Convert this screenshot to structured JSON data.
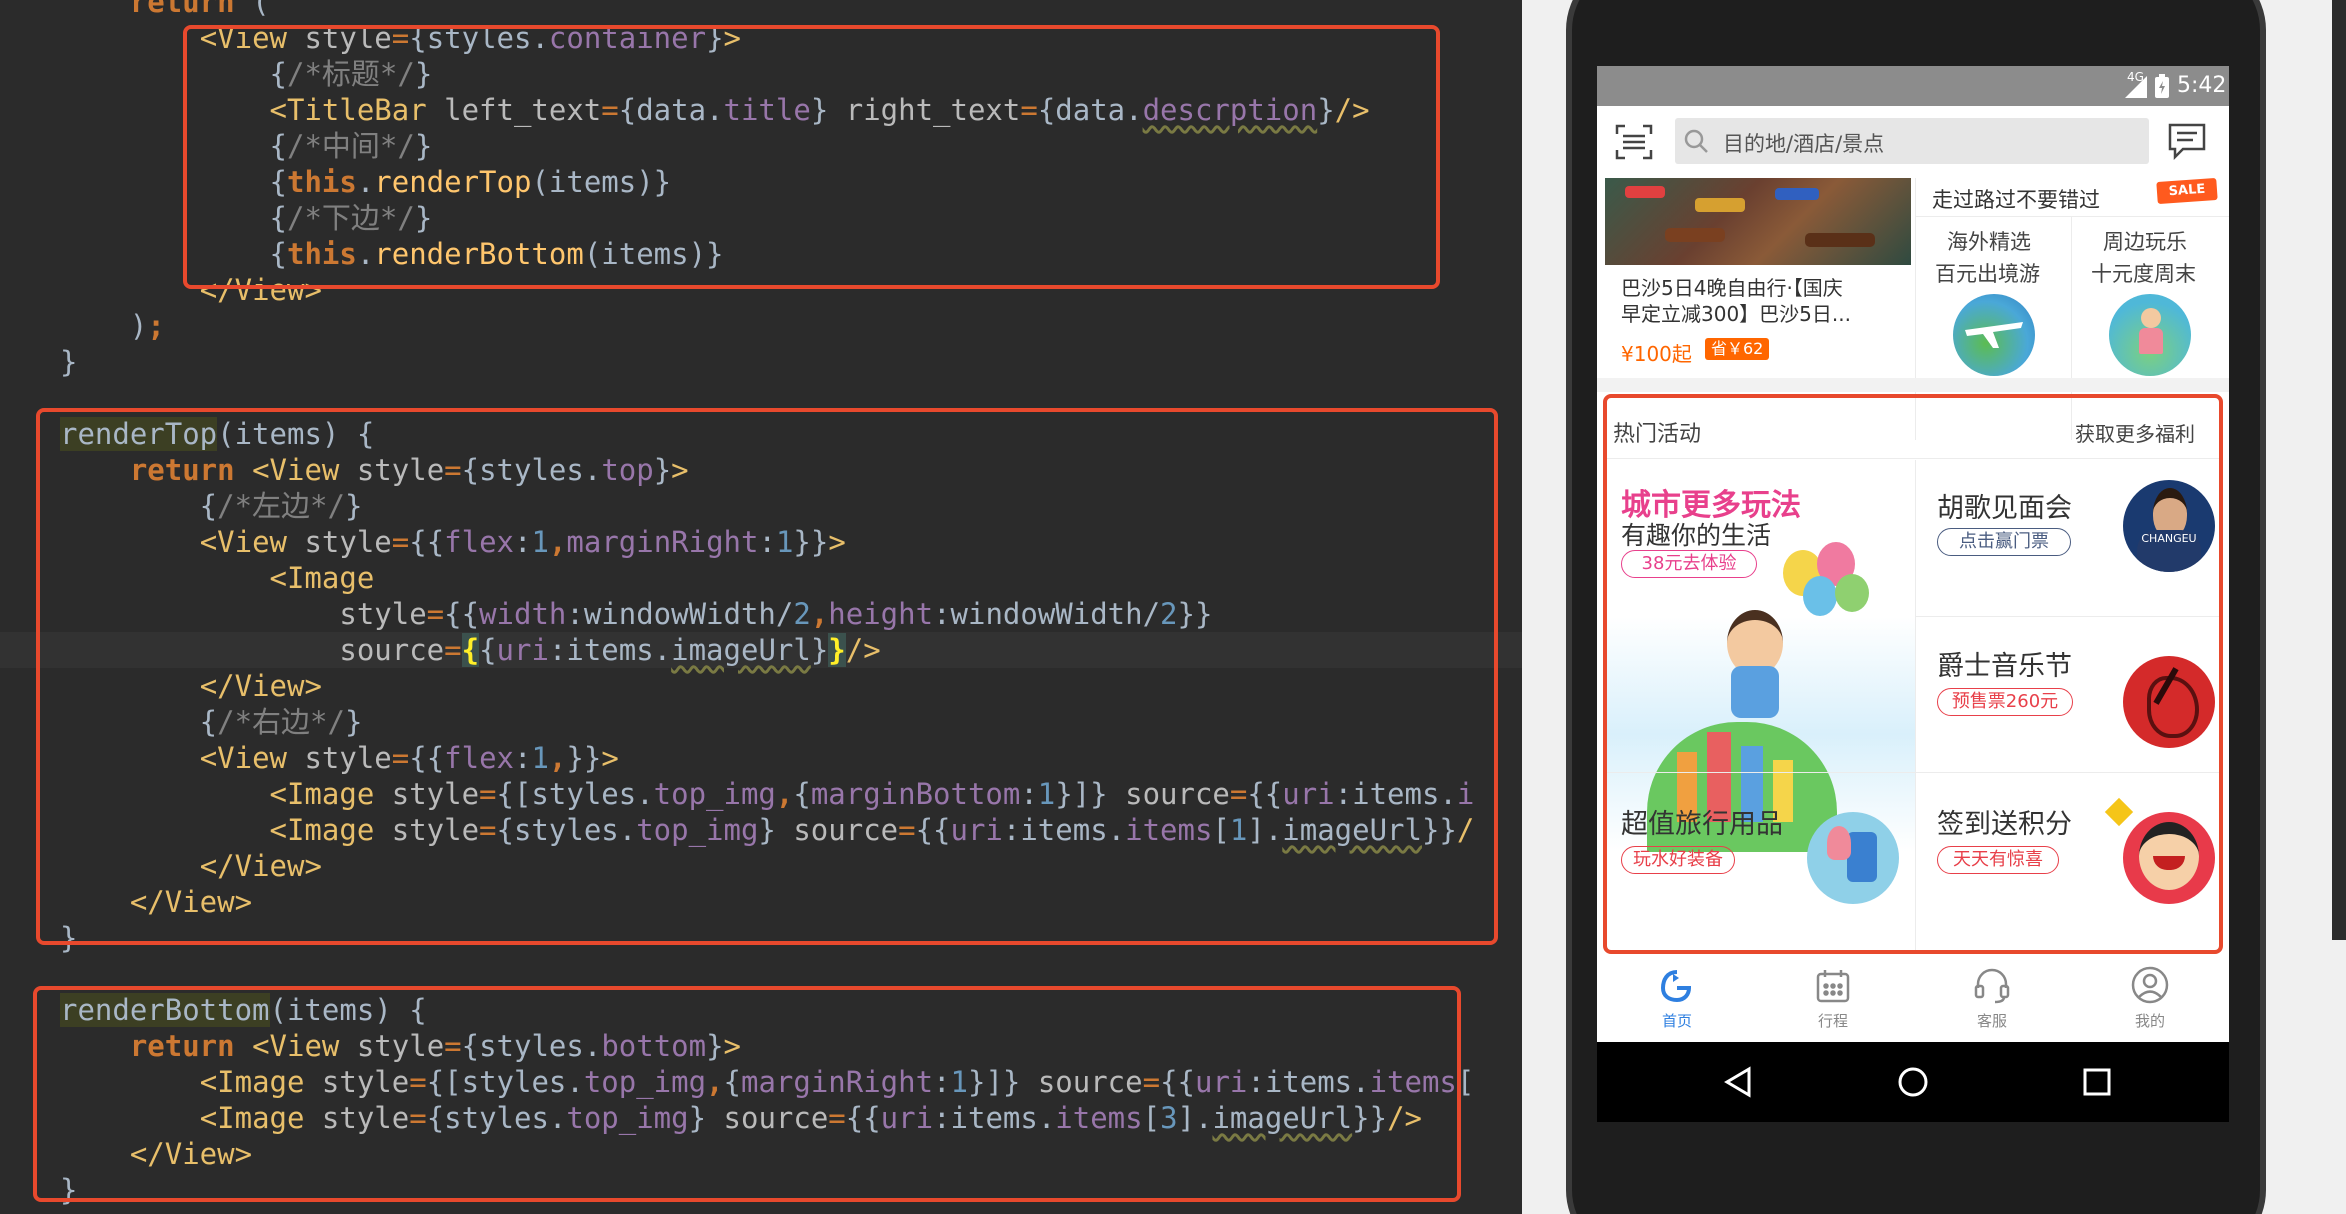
{
  "editor": {
    "lines": [
      {
        "tokens": [
          {
            "t": "    ",
            "c": "t-plain"
          },
          {
            "t": "return",
            "c": "t-kw"
          },
          {
            "t": " (",
            "c": "t-plain"
          }
        ]
      },
      {
        "tokens": [
          {
            "t": "        ",
            "c": "t-plain"
          },
          {
            "t": "<View",
            "c": "t-tag"
          },
          {
            "t": " style",
            "c": "t-attr"
          },
          {
            "t": "=",
            "c": "t-eq"
          },
          {
            "t": "{styles.",
            "c": "t-plain"
          },
          {
            "t": "container",
            "c": "t-prop"
          },
          {
            "t": "}",
            "c": "t-plain"
          },
          {
            "t": ">",
            "c": "t-tag"
          }
        ]
      },
      {
        "tokens": [
          {
            "t": "            {",
            "c": "t-plain"
          },
          {
            "t": "/*标题*/",
            "c": "t-cmt"
          },
          {
            "t": "}",
            "c": "t-plain"
          }
        ]
      },
      {
        "tokens": [
          {
            "t": "            ",
            "c": "t-plain"
          },
          {
            "t": "<TitleBar",
            "c": "t-tag"
          },
          {
            "t": " left_text",
            "c": "t-attr"
          },
          {
            "t": "=",
            "c": "t-eq"
          },
          {
            "t": "{data.",
            "c": "t-plain"
          },
          {
            "t": "title",
            "c": "t-prop"
          },
          {
            "t": "}",
            "c": "t-plain"
          },
          {
            "t": " right_text",
            "c": "t-attr"
          },
          {
            "t": "=",
            "c": "t-eq"
          },
          {
            "t": "{data.",
            "c": "t-plain"
          },
          {
            "t": "descrption",
            "c": "t-prop t-wavy"
          },
          {
            "t": "}",
            "c": "t-plain"
          },
          {
            "t": "/>",
            "c": "t-tag"
          }
        ]
      },
      {
        "tokens": [
          {
            "t": "            {",
            "c": "t-plain"
          },
          {
            "t": "/*中间*/",
            "c": "t-cmt"
          },
          {
            "t": "}",
            "c": "t-plain"
          }
        ]
      },
      {
        "tokens": [
          {
            "t": "            {",
            "c": "t-plain"
          },
          {
            "t": "this",
            "c": "t-kw"
          },
          {
            "t": ".",
            "c": "t-plain"
          },
          {
            "t": "renderTop",
            "c": "t-fn"
          },
          {
            "t": "(items)}",
            "c": "t-plain"
          }
        ]
      },
      {
        "tokens": [
          {
            "t": "            {",
            "c": "t-plain"
          },
          {
            "t": "/*下边*/",
            "c": "t-cmt"
          },
          {
            "t": "}",
            "c": "t-plain"
          }
        ]
      },
      {
        "tokens": [
          {
            "t": "            {",
            "c": "t-plain"
          },
          {
            "t": "this",
            "c": "t-kw"
          },
          {
            "t": ".",
            "c": "t-plain"
          },
          {
            "t": "renderBottom",
            "c": "t-fn"
          },
          {
            "t": "(items)}",
            "c": "t-plain"
          }
        ]
      },
      {
        "tokens": [
          {
            "t": "        ",
            "c": "t-plain"
          },
          {
            "t": "</View>",
            "c": "t-tag"
          }
        ]
      },
      {
        "tokens": [
          {
            "t": "    )",
            "c": "t-plain"
          },
          {
            "t": ";",
            "c": "t-kw"
          }
        ]
      },
      {
        "tokens": [
          {
            "t": "}",
            "c": "t-plain"
          }
        ]
      },
      {
        "tokens": []
      },
      {
        "tokens": [
          {
            "t": "renderTop",
            "c": "t-fnh"
          },
          {
            "t": "(items) {",
            "c": "t-plain"
          }
        ]
      },
      {
        "tokens": [
          {
            "t": "    ",
            "c": "t-plain"
          },
          {
            "t": "return",
            "c": "t-kw"
          },
          {
            "t": " ",
            "c": "t-plain"
          },
          {
            "t": "<View",
            "c": "t-tag"
          },
          {
            "t": " style",
            "c": "t-attr"
          },
          {
            "t": "=",
            "c": "t-eq"
          },
          {
            "t": "{styles.",
            "c": "t-plain"
          },
          {
            "t": "top",
            "c": "t-prop"
          },
          {
            "t": "}",
            "c": "t-plain"
          },
          {
            "t": ">",
            "c": "t-tag"
          }
        ]
      },
      {
        "tokens": [
          {
            "t": "        {",
            "c": "t-plain"
          },
          {
            "t": "/*左边*/",
            "c": "t-cmt"
          },
          {
            "t": "}",
            "c": "t-plain"
          }
        ]
      },
      {
        "tokens": [
          {
            "t": "        ",
            "c": "t-plain"
          },
          {
            "t": "<View",
            "c": "t-tag"
          },
          {
            "t": " style",
            "c": "t-attr"
          },
          {
            "t": "=",
            "c": "t-eq"
          },
          {
            "t": "{{",
            "c": "t-plain"
          },
          {
            "t": "flex",
            "c": "t-prop"
          },
          {
            "t": ":",
            "c": "t-plain"
          },
          {
            "t": "1",
            "c": "t-num"
          },
          {
            "t": ",",
            "c": "t-kw"
          },
          {
            "t": "marginRight",
            "c": "t-prop"
          },
          {
            "t": ":",
            "c": "t-plain"
          },
          {
            "t": "1",
            "c": "t-num"
          },
          {
            "t": "}}",
            "c": "t-plain"
          },
          {
            "t": ">",
            "c": "t-tag"
          }
        ]
      },
      {
        "tokens": [
          {
            "t": "            ",
            "c": "t-plain"
          },
          {
            "t": "<Image",
            "c": "t-tag"
          }
        ]
      },
      {
        "tokens": [
          {
            "t": "                ",
            "c": "t-plain"
          },
          {
            "t": "style",
            "c": "t-attr"
          },
          {
            "t": "=",
            "c": "t-eq"
          },
          {
            "t": "{{",
            "c": "t-plain"
          },
          {
            "t": "width",
            "c": "t-prop"
          },
          {
            "t": ":windowWidth/",
            "c": "t-plain"
          },
          {
            "t": "2",
            "c": "t-num"
          },
          {
            "t": ",",
            "c": "t-kw"
          },
          {
            "t": "height",
            "c": "t-prop"
          },
          {
            "t": ":windowWidth/",
            "c": "t-plain"
          },
          {
            "t": "2",
            "c": "t-num"
          },
          {
            "t": "}}",
            "c": "t-plain"
          }
        ]
      },
      {
        "hl": true,
        "tokens": [
          {
            "t": "                ",
            "c": "t-plain"
          },
          {
            "t": "source",
            "c": "t-attr"
          },
          {
            "t": "=",
            "c": "t-eq"
          },
          {
            "t": "{",
            "c": "t-bracehl"
          },
          {
            "t": "{",
            "c": "t-plain"
          },
          {
            "t": "uri",
            "c": "t-prop"
          },
          {
            "t": ":items.",
            "c": "t-plain"
          },
          {
            "t": "imageUrl",
            "c": "t-plain t-wavy"
          },
          {
            "t": "}",
            "c": "t-plain"
          },
          {
            "t": "}",
            "c": "t-bracehl"
          },
          {
            "t": "/>",
            "c": "t-tag"
          }
        ]
      },
      {
        "tokens": [
          {
            "t": "        ",
            "c": "t-plain"
          },
          {
            "t": "</View>",
            "c": "t-tag"
          }
        ]
      },
      {
        "tokens": [
          {
            "t": "        {",
            "c": "t-plain"
          },
          {
            "t": "/*右边*/",
            "c": "t-cmt"
          },
          {
            "t": "}",
            "c": "t-plain"
          }
        ]
      },
      {
        "tokens": [
          {
            "t": "        ",
            "c": "t-plain"
          },
          {
            "t": "<View",
            "c": "t-tag"
          },
          {
            "t": " style",
            "c": "t-attr"
          },
          {
            "t": "=",
            "c": "t-eq"
          },
          {
            "t": "{{",
            "c": "t-plain"
          },
          {
            "t": "flex",
            "c": "t-prop"
          },
          {
            "t": ":",
            "c": "t-plain"
          },
          {
            "t": "1",
            "c": "t-num"
          },
          {
            "t": ",",
            "c": "t-kw"
          },
          {
            "t": "}}",
            "c": "t-plain"
          },
          {
            "t": ">",
            "c": "t-tag"
          }
        ]
      },
      {
        "tokens": [
          {
            "t": "            ",
            "c": "t-plain"
          },
          {
            "t": "<Image",
            "c": "t-tag"
          },
          {
            "t": " style",
            "c": "t-attr"
          },
          {
            "t": "=",
            "c": "t-eq"
          },
          {
            "t": "{[styles.",
            "c": "t-plain"
          },
          {
            "t": "top_img",
            "c": "t-prop"
          },
          {
            "t": ",",
            "c": "t-kw"
          },
          {
            "t": "{",
            "c": "t-plain"
          },
          {
            "t": "marginBottom",
            "c": "t-prop"
          },
          {
            "t": ":",
            "c": "t-plain"
          },
          {
            "t": "1",
            "c": "t-num"
          },
          {
            "t": "}]}",
            "c": "t-plain"
          },
          {
            "t": " source",
            "c": "t-attr"
          },
          {
            "t": "=",
            "c": "t-eq"
          },
          {
            "t": "{{",
            "c": "t-plain"
          },
          {
            "t": "uri",
            "c": "t-prop"
          },
          {
            "t": ":items.",
            "c": "t-plain"
          },
          {
            "t": "i",
            "c": "t-prop"
          }
        ]
      },
      {
        "tokens": [
          {
            "t": "            ",
            "c": "t-plain"
          },
          {
            "t": "<Image",
            "c": "t-tag"
          },
          {
            "t": " style",
            "c": "t-attr"
          },
          {
            "t": "=",
            "c": "t-eq"
          },
          {
            "t": "{styles.",
            "c": "t-plain"
          },
          {
            "t": "top_img",
            "c": "t-prop"
          },
          {
            "t": "}",
            "c": "t-plain"
          },
          {
            "t": " source",
            "c": "t-attr"
          },
          {
            "t": "=",
            "c": "t-eq"
          },
          {
            "t": "{{",
            "c": "t-plain"
          },
          {
            "t": "uri",
            "c": "t-prop"
          },
          {
            "t": ":items.",
            "c": "t-plain"
          },
          {
            "t": "items",
            "c": "t-prop"
          },
          {
            "t": "[",
            "c": "t-plain"
          },
          {
            "t": "1",
            "c": "t-num"
          },
          {
            "t": "].",
            "c": "t-plain"
          },
          {
            "t": "imageUrl",
            "c": "t-plain t-wavy"
          },
          {
            "t": "}}",
            "c": "t-plain"
          },
          {
            "t": "/",
            "c": "t-tag"
          }
        ]
      },
      {
        "tokens": [
          {
            "t": "        ",
            "c": "t-plain"
          },
          {
            "t": "</View>",
            "c": "t-tag"
          }
        ]
      },
      {
        "tokens": [
          {
            "t": "    ",
            "c": "t-plain"
          },
          {
            "t": "</View>",
            "c": "t-tag"
          }
        ]
      },
      {
        "tokens": [
          {
            "t": "}",
            "c": "t-plain"
          }
        ]
      },
      {
        "tokens": []
      },
      {
        "tokens": [
          {
            "t": "renderBottom",
            "c": "t-fnh"
          },
          {
            "t": "(items) {",
            "c": "t-plain"
          }
        ]
      },
      {
        "tokens": [
          {
            "t": "    ",
            "c": "t-plain"
          },
          {
            "t": "return",
            "c": "t-kw"
          },
          {
            "t": " ",
            "c": "t-plain"
          },
          {
            "t": "<View",
            "c": "t-tag"
          },
          {
            "t": " style",
            "c": "t-attr"
          },
          {
            "t": "=",
            "c": "t-eq"
          },
          {
            "t": "{styles.",
            "c": "t-plain"
          },
          {
            "t": "bottom",
            "c": "t-prop"
          },
          {
            "t": "}",
            "c": "t-plain"
          },
          {
            "t": ">",
            "c": "t-tag"
          }
        ]
      },
      {
        "tokens": [
          {
            "t": "        ",
            "c": "t-plain"
          },
          {
            "t": "<Image",
            "c": "t-tag"
          },
          {
            "t": " style",
            "c": "t-attr"
          },
          {
            "t": "=",
            "c": "t-eq"
          },
          {
            "t": "{[styles.",
            "c": "t-plain"
          },
          {
            "t": "top_img",
            "c": "t-prop"
          },
          {
            "t": ",",
            "c": "t-kw"
          },
          {
            "t": "{",
            "c": "t-plain"
          },
          {
            "t": "marginRight",
            "c": "t-prop"
          },
          {
            "t": ":",
            "c": "t-plain"
          },
          {
            "t": "1",
            "c": "t-num"
          },
          {
            "t": "}]}",
            "c": "t-plain"
          },
          {
            "t": " source",
            "c": "t-attr"
          },
          {
            "t": "=",
            "c": "t-eq"
          },
          {
            "t": "{{",
            "c": "t-plain"
          },
          {
            "t": "uri",
            "c": "t-prop"
          },
          {
            "t": ":items.",
            "c": "t-plain"
          },
          {
            "t": "items",
            "c": "t-prop"
          },
          {
            "t": "[",
            "c": "t-plain"
          }
        ]
      },
      {
        "tokens": [
          {
            "t": "        ",
            "c": "t-plain"
          },
          {
            "t": "<Image",
            "c": "t-tag"
          },
          {
            "t": " style",
            "c": "t-attr"
          },
          {
            "t": "=",
            "c": "t-eq"
          },
          {
            "t": "{styles.",
            "c": "t-plain"
          },
          {
            "t": "top_img",
            "c": "t-prop"
          },
          {
            "t": "}",
            "c": "t-plain"
          },
          {
            "t": " source",
            "c": "t-attr"
          },
          {
            "t": "=",
            "c": "t-eq"
          },
          {
            "t": "{{",
            "c": "t-plain"
          },
          {
            "t": "uri",
            "c": "t-prop"
          },
          {
            "t": ":items.",
            "c": "t-plain"
          },
          {
            "t": "items",
            "c": "t-prop"
          },
          {
            "t": "[",
            "c": "t-plain"
          },
          {
            "t": "3",
            "c": "t-num"
          },
          {
            "t": "].",
            "c": "t-plain"
          },
          {
            "t": "imageUrl",
            "c": "t-plain t-wavy"
          },
          {
            "t": "}}",
            "c": "t-plain"
          },
          {
            "t": "/>",
            "c": "t-tag"
          }
        ]
      },
      {
        "tokens": [
          {
            "t": "    ",
            "c": "t-plain"
          },
          {
            "t": "</View>",
            "c": "t-tag"
          }
        ]
      },
      {
        "tokens": [
          {
            "t": "}",
            "c": "t-plain"
          }
        ]
      }
    ]
  },
  "annotation_color": "#e8492d",
  "phone": {
    "status": {
      "network": "4G",
      "time": "5:42"
    },
    "search": {
      "placeholder": "目的地/酒店/景点"
    },
    "icons": {
      "scan": "scan-icon",
      "message": "message-icon",
      "search": "search-icon"
    },
    "promo": {
      "banner_text": "走过路过不要错过",
      "sale_badge": "SALE",
      "trip_title_line1": "巴沙5日4晚自由行·【国庆",
      "trip_title_line2": "早定立减300】巴沙5日...",
      "price": "¥100起",
      "save_badge": "省￥62",
      "card1_line1": "海外精选",
      "card1_line2": "百元出境游",
      "card2_line1": "周边玩乐",
      "card2_line2": "十元度周末"
    },
    "hot": {
      "title": "热门活动",
      "more": "获取更多福利",
      "main_title": "城市更多玩法",
      "main_subtitle": "有趣你的生活",
      "main_pill": "38元去体验",
      "item1_title": "胡歌见面会",
      "item1_pill": "点击赢门票",
      "item1_brand": "CHANGEU",
      "item2_title": "爵士音乐节",
      "item2_pill": "预售票260元",
      "item3_title": "超值旅行用品",
      "item3_pill": "玩水好装备",
      "item4_title": "签到送积分",
      "item4_pill": "天天有惊喜"
    },
    "tabs": [
      {
        "label": "首页",
        "icon": "home-icon",
        "active": true
      },
      {
        "label": "行程",
        "icon": "calendar-icon",
        "active": false
      },
      {
        "label": "客服",
        "icon": "headset-icon",
        "active": false
      },
      {
        "label": "我的",
        "icon": "user-icon",
        "active": false
      }
    ],
    "colors": {
      "accent": "#ff6600",
      "tab_active": "#2e7fe0",
      "pill_red": "#e8404a",
      "pill_blue": "#4a5c80",
      "pink_title": "#e8408c"
    }
  }
}
